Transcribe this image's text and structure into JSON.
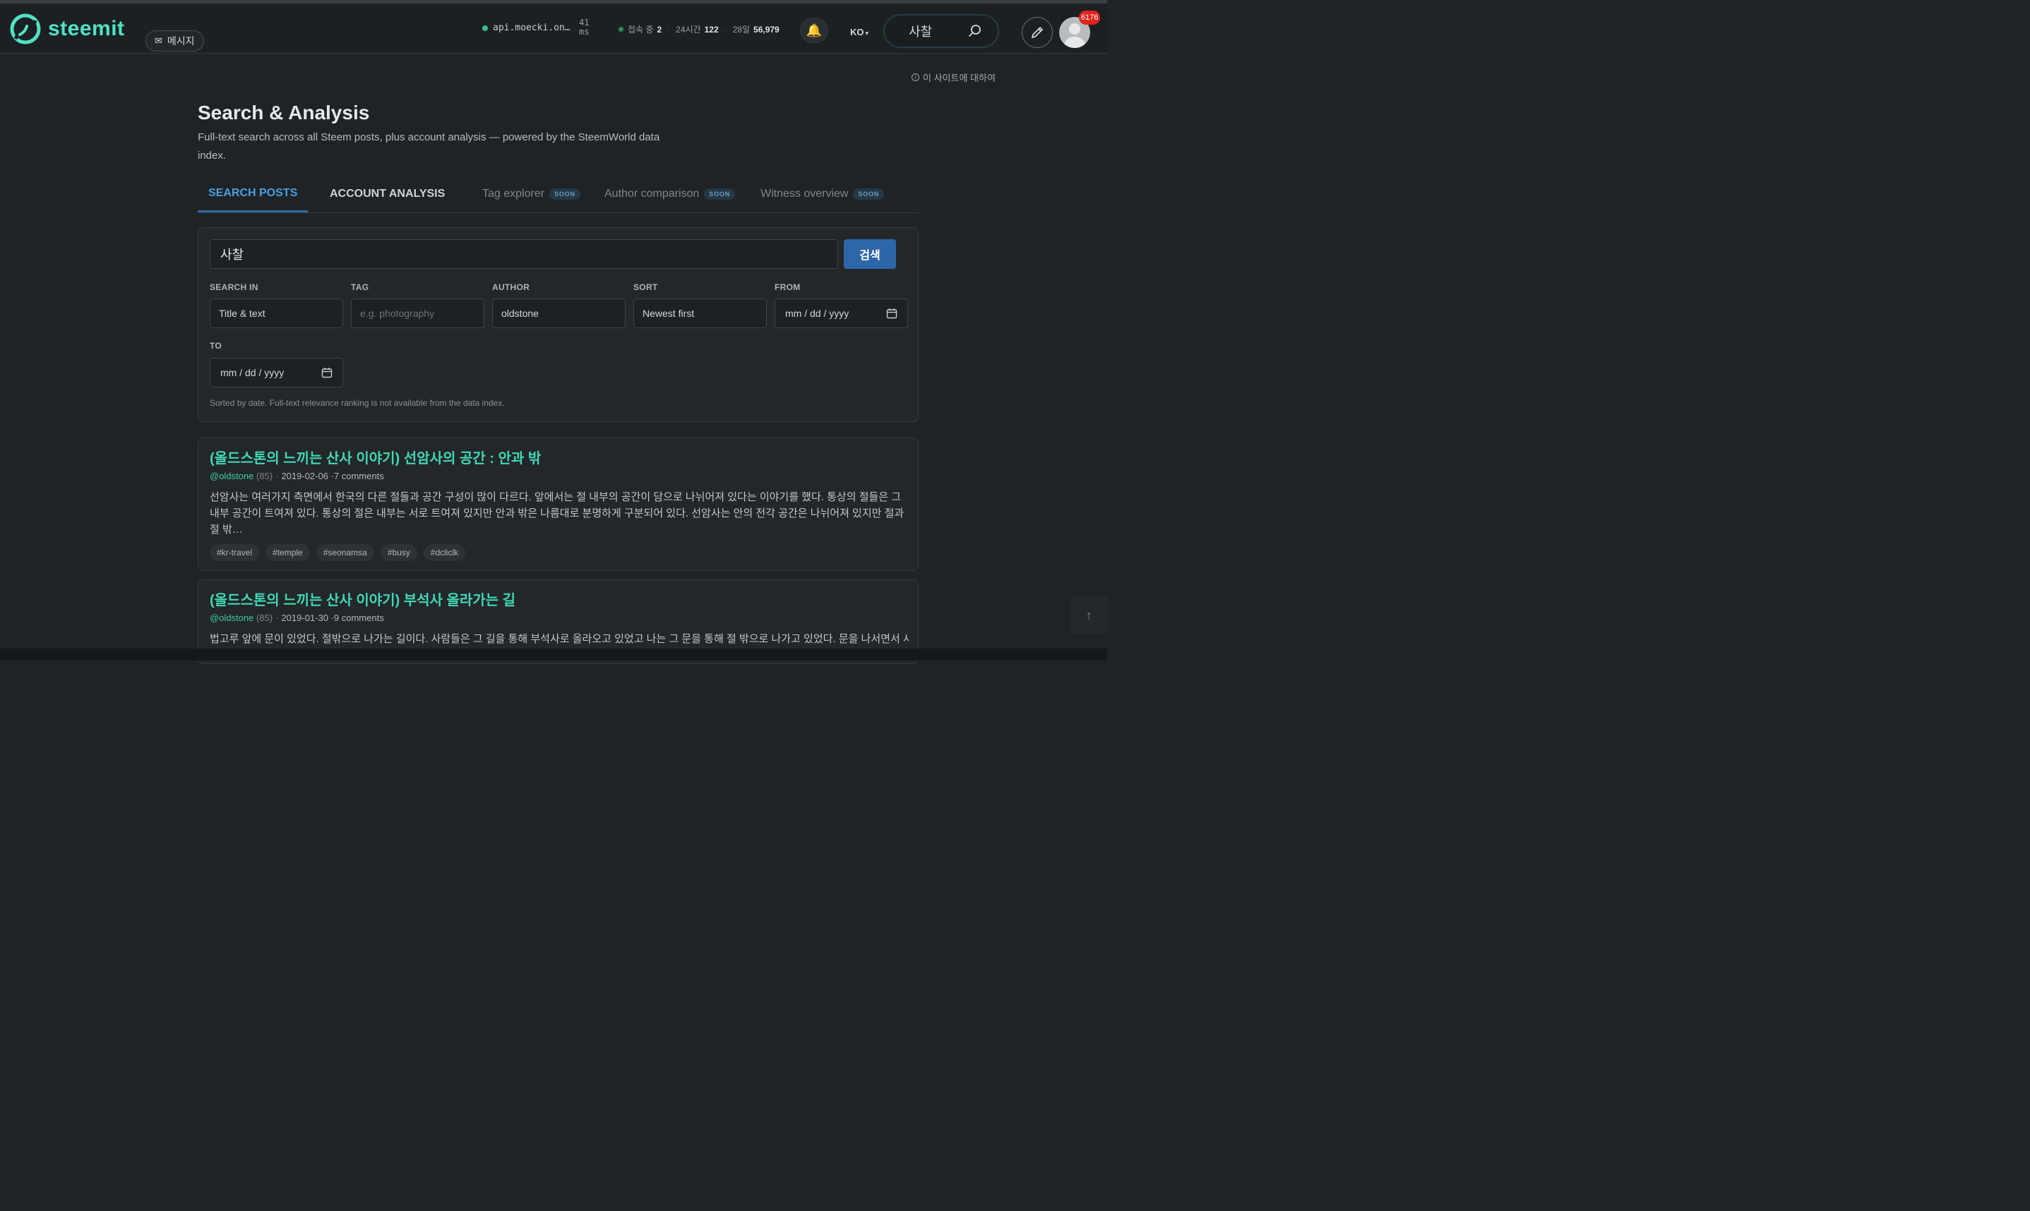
{
  "header": {
    "logo_text": "steemit",
    "message_label": "메시지",
    "api_node": "api.moecki.on…",
    "latency_value": "41",
    "latency_unit": "ms",
    "online_label": "접속 중",
    "online_count": "2",
    "day_label": "24시간",
    "day_count": "122",
    "month_label": "28일",
    "month_count": "56,979",
    "language": "KO",
    "search_query": "사찰",
    "notification_count": "6176"
  },
  "about_link": "이 사이트에 대하여",
  "page": {
    "title": "Search & Analysis",
    "subtitle": "Full-text search across all Steem posts, plus account analysis — powered by the SteemWorld data index."
  },
  "tabs": [
    {
      "label": "SEARCH POSTS",
      "state": "active"
    },
    {
      "label": "ACCOUNT ANALYSIS",
      "state": "normal"
    },
    {
      "label": "Tag explorer",
      "badge": "SOON"
    },
    {
      "label": "Author comparison",
      "badge": "SOON"
    },
    {
      "label": "Witness overview",
      "badge": "SOON"
    }
  ],
  "search_form": {
    "query": "사찰",
    "submit_label": "검색",
    "search_in_label": "SEARCH IN",
    "search_in_value": "Title & text",
    "tag_label": "TAG",
    "tag_placeholder": "e.g. photography",
    "author_label": "AUTHOR",
    "author_value": "oldstone",
    "sort_label": "SORT",
    "sort_value": "Newest first",
    "from_label": "FROM",
    "from_placeholder": "mm / dd / yyyy",
    "to_label": "TO",
    "to_placeholder": "mm / dd / yyyy",
    "note": "Sorted by date. Full-text relevance ranking is not available from the data index."
  },
  "results": [
    {
      "title": "(올드스톤의 느끼는 산사 이야기) 선암사의 공간 : 안과 밖",
      "author": "@oldstone",
      "reputation": "(85)",
      "date": "2019-02-06",
      "comments": "·7 comments",
      "excerpt": "선암사는 여러가지 측면에서 한국의 다른 절들과 공간 구성이 많이 다르다. 앞에서는 절 내부의 공간이 담으로 나뉘어져 있다는 이야기를 했다. 통상의 절들은 그 내부 공간이 트여져 있다. 통상의 절은 내부는 서로 트여져 있지만 안과 밖은 나름대로 분명하게 구분되어 있다. 선암사는 안의 전각 공간은 나뉘어져 있지만 절과 절 밖…",
      "tags": [
        "#kr-travel",
        "#temple",
        "#seonamsa",
        "#busy",
        "#dcliclk"
      ]
    },
    {
      "title": "(올드스톤의 느끼는 산사 이야기) 부석사 올라가는 길",
      "author": "@oldstone",
      "reputation": "(85)",
      "date": "2019-01-30",
      "comments": "·9 comments",
      "excerpt": "법고루 앞에 문이 있었다. 절밖으로 나가는 길이다. 사람들은 그 길을 통해 부석사로 올라오고 있었고 나는 그 문을 통해 절 밖으로 나가고 있었다. 문을 나서면서 사"
    }
  ],
  "colors": {
    "accent": "#41d8b4",
    "brand": "#4fe3c5",
    "primary_button": "#2e67a8",
    "active_tab": "#4a9fe0",
    "background": "#1f2326"
  }
}
